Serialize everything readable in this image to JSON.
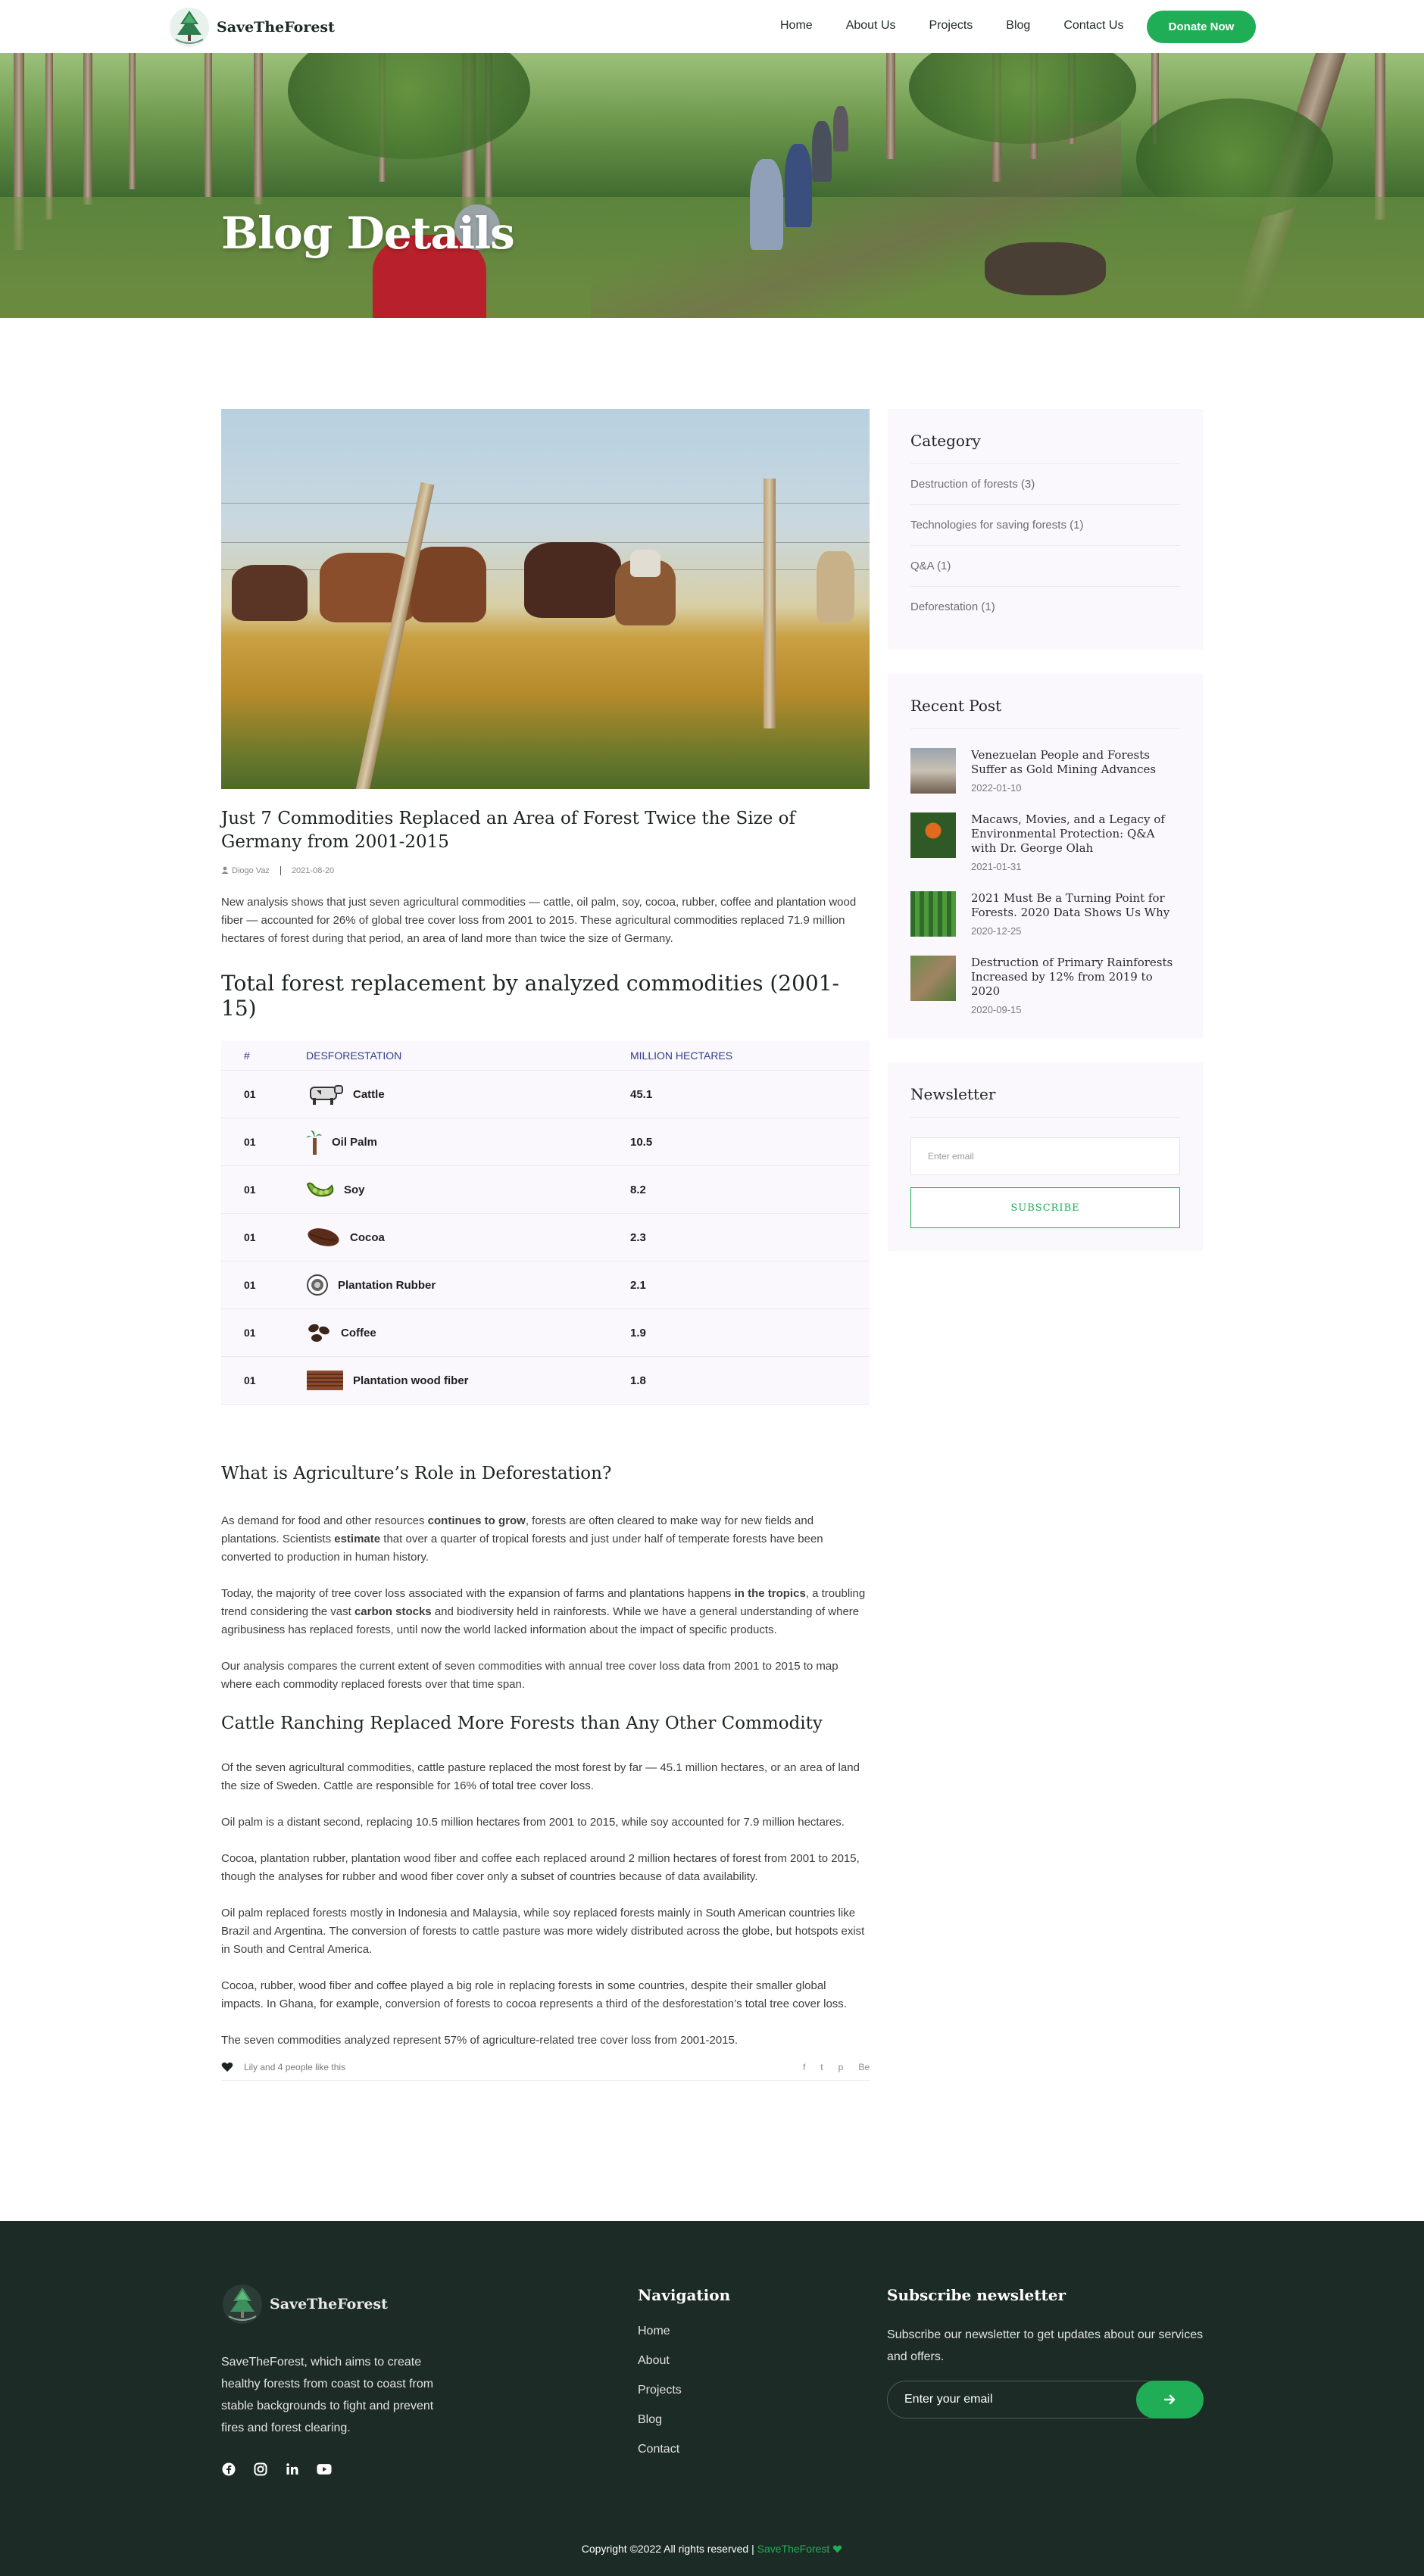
{
  "brand": {
    "name": "SaveTheForest",
    "accent_color": "#1fae55",
    "dark_color": "#1d2b26"
  },
  "nav": {
    "items": [
      "Home",
      "About Us",
      "Projects",
      "Blog",
      "Contact Us"
    ],
    "cta": "Donate Now"
  },
  "hero": {
    "title": "Blog Details"
  },
  "post": {
    "title": "Just 7 Commodities Replaced an Area of Forest Twice the Size of Germany from 2001-2015",
    "author": "Diogo Vaz",
    "date": "2021-08-20",
    "intro": "New analysis shows that just seven agricultural commodities — cattle, oil palm, soy, cocoa, rubber, coffee and plantation wood fiber — accounted for 26% of global tree cover loss from 2001 to 2015. These agricultural commodities replaced 71.9 million hectares of forest during that period, an area of land more than twice the size of Germany.",
    "table_title": "Total forest replacement by analyzed commodities (2001-15)",
    "table": {
      "headers": [
        "#",
        "Desforestation",
        "Million hectares"
      ],
      "rows": [
        {
          "num": "01",
          "name": "Cattle",
          "value": "45.1",
          "icon": "cow-icon"
        },
        {
          "num": "01",
          "name": "Oil Palm",
          "value": "10.5",
          "icon": "palm-tree-icon"
        },
        {
          "num": "01",
          "name": "Soy",
          "value": "8.2",
          "icon": "soybean-icon"
        },
        {
          "num": "01",
          "name": "Cocoa",
          "value": "2.3",
          "icon": "cocoa-bean-icon"
        },
        {
          "num": "01",
          "name": "Plantation Rubber",
          "value": "2.1",
          "icon": "rubber-icon"
        },
        {
          "num": "01",
          "name": "Coffee",
          "value": "1.9",
          "icon": "coffee-bean-icon"
        },
        {
          "num": "01",
          "name": "Plantation wood fiber",
          "value": "1.8",
          "icon": "wood-fiber-icon"
        }
      ]
    },
    "section1": {
      "heading": "What is Agriculture’s Role in Deforestation?",
      "p1": {
        "a": "As demand for food and other resources ",
        "b": "continues to grow",
        "c": ", forests are often cleared to make way for new fields and plantations. Scientists ",
        "d": "estimate",
        "e": " that over a quarter of tropical forests and just under half of temperate forests have been converted to production in human history."
      },
      "p2": {
        "a": "Today, the majority of tree cover loss associated with the expansion of farms and plantations happens ",
        "b": "in the tropics",
        "c": ", a troubling trend considering the vast ",
        "d": "carbon stocks",
        "e": " and biodiversity held in rainforests. While we have a general understanding of where agribusiness has replaced forests, until now the world lacked information about the impact of specific products."
      },
      "p3": "Our analysis compares the current extent of seven commodities with annual tree cover loss data from 2001 to 2015 to map where each commodity replaced forests over that time span."
    },
    "section2": {
      "heading": "Cattle Ranching Replaced More Forests than Any Other Commodity",
      "paragraphs": [
        "Of the seven agricultural commodities, cattle pasture replaced the most forest by far — 45.1 million hectares, or an area of land the size of Sweden. Cattle are responsible for 16% of total tree cover loss.",
        "Oil palm is a distant second, replacing 10.5 million hectares from 2001 to 2015, while soy accounted for 7.9 million hectares.",
        "Cocoa, plantation rubber, plantation wood fiber and coffee each replaced around 2 million hectares of forest from 2001 to 2015, though the analyses for rubber and wood fiber cover only a subset of countries because of data availability.",
        "Oil palm replaced forests mostly in Indonesia and Malaysia, while soy replaced forests mainly in South American countries like Brazil and Argentina. The conversion of forests to cattle pasture was more widely distributed across the globe, but hotspots exist in South and Central America.",
        "Cocoa, rubber, wood fiber and coffee played a big role in replacing forests in some countries, despite their smaller global impacts. In Ghana, for example, conversion of forests to cocoa represents a third of the desforestation’s total tree cover loss.",
        "The seven commodities analyzed represent 57% of agriculture-related tree cover loss from 2001-2015."
      ]
    },
    "likes": "Lily and 4 people like this",
    "share": [
      "f",
      "t",
      "p",
      "Be"
    ]
  },
  "sidebar": {
    "category": {
      "title": "Category",
      "items": [
        "Destruction of forests (3)",
        "Technologies for saving forests (1)",
        "Q&A (1)",
        "Deforestation (1)"
      ]
    },
    "recent": {
      "title": "Recent Post",
      "posts": [
        {
          "title": "Venezuelan People and Forests Suffer as Gold Mining Advances",
          "date": "2022-01-10"
        },
        {
          "title": "Macaws, Movies, and a Legacy of Environmental Protection: Q&A with Dr. George Olah",
          "date": "2021-01-31"
        },
        {
          "title": "2021 Must Be a Turning Point for Forests. 2020 Data Shows Us Why",
          "date": "2020-12-25"
        },
        {
          "title": "Destruction of Primary Rainforests Increased by 12% from 2019 to 2020",
          "date": "2020-09-15"
        }
      ]
    },
    "newsletter": {
      "title": "Newsletter",
      "placeholder": "Enter email",
      "button": "SUBSCRIBE"
    }
  },
  "footer": {
    "description": "SaveTheForest, which aims to create healthy forests from coast to coast from stable backgrounds to fight and prevent fires and forest clearing.",
    "social": [
      "facebook-icon",
      "instagram-icon",
      "linkedin-icon",
      "youtube-icon"
    ],
    "nav_title": "Navigation",
    "nav_items": [
      "Home",
      "About",
      "Projects",
      "Blog",
      "Contact"
    ],
    "subscribe_title": "Subscribe newsletter",
    "subscribe_text": "Subscribe our newsletter to get updates about our services and offers.",
    "email_placeholder": "Enter your email",
    "copyright": "Copyright ©2022 All rights reserved | ",
    "copyright_brand": "SaveTheForest"
  }
}
